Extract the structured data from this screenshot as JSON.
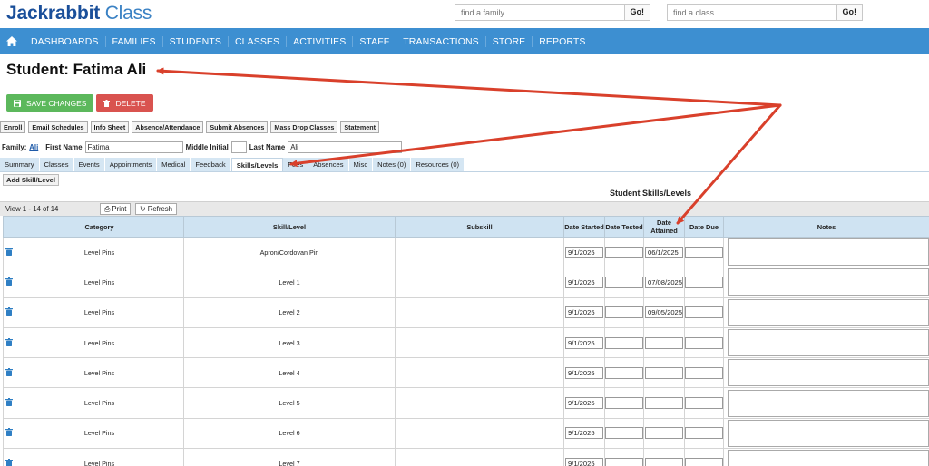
{
  "brand": {
    "bold": "Jackrabbit",
    "light": "Class"
  },
  "search": {
    "family_placeholder": "find a family...",
    "class_placeholder": "find a class...",
    "go_label": "Go!"
  },
  "nav": {
    "items": [
      "DASHBOARDS",
      "FAMILIES",
      "STUDENTS",
      "CLASSES",
      "ACTIVITIES",
      "STAFF",
      "TRANSACTIONS",
      "STORE",
      "REPORTS"
    ]
  },
  "page": {
    "title": "Student: Fatima Ali"
  },
  "buttons": {
    "save": "SAVE CHANGES",
    "delete": "DELETE"
  },
  "actions": [
    "Enroll",
    "Email Schedules",
    "Info Sheet",
    "Absence/Attendance",
    "Submit Absences",
    "Mass Drop Classes",
    "Statement"
  ],
  "student": {
    "family_label": "Family:",
    "family_value": "Ali",
    "first_name_label": "First Name",
    "first_name": "Fatima",
    "middle_label": "Middle Initial",
    "middle": "",
    "last_name_label": "Last Name",
    "last_name": "Ali"
  },
  "tabs": [
    "Summary",
    "Classes",
    "Events",
    "Appointments",
    "Medical",
    "Feedback",
    "Skills/Levels",
    "Fees",
    "Absences",
    "Misc",
    "Notes (0)",
    "Resources (0)"
  ],
  "active_tab": "Skills/Levels",
  "add_skill_label": "Add Skill/Level",
  "section_title": "Student Skills/Levels",
  "viewbar": {
    "count": "View 1 - 14 of 14",
    "print": "Print",
    "refresh": "Refresh"
  },
  "table": {
    "headers": {
      "category": "Category",
      "skill": "Skill/Level",
      "subskill": "Subskill",
      "date_started": "Date Started",
      "date_tested": "Date Tested",
      "date_attained": "Date Attained",
      "date_due": "Date Due",
      "notes": "Notes"
    },
    "rows": [
      {
        "category": "Level Pins",
        "skill": "Apron/Cordovan Pin",
        "subskill": "",
        "started": "9/1/2025",
        "tested": "",
        "attained": "06/1/2025",
        "due": ""
      },
      {
        "category": "Level Pins",
        "skill": "Level 1",
        "subskill": "",
        "started": "9/1/2025",
        "tested": "",
        "attained": "07/08/2025",
        "due": ""
      },
      {
        "category": "Level Pins",
        "skill": "Level 2",
        "subskill": "",
        "started": "9/1/2025",
        "tested": "",
        "attained": "09/05/2025",
        "due": ""
      },
      {
        "category": "Level Pins",
        "skill": "Level 3",
        "subskill": "",
        "started": "9/1/2025",
        "tested": "",
        "attained": "",
        "due": ""
      },
      {
        "category": "Level Pins",
        "skill": "Level 4",
        "subskill": "",
        "started": "9/1/2025",
        "tested": "",
        "attained": "",
        "due": ""
      },
      {
        "category": "Level Pins",
        "skill": "Level 5",
        "subskill": "",
        "started": "9/1/2025",
        "tested": "",
        "attained": "",
        "due": ""
      },
      {
        "category": "Level Pins",
        "skill": "Level 6",
        "subskill": "",
        "started": "9/1/2025",
        "tested": "",
        "attained": "",
        "due": ""
      },
      {
        "category": "Level Pins",
        "skill": "Level 7",
        "subskill": "",
        "started": "9/1/2025",
        "tested": "",
        "attained": "",
        "due": ""
      }
    ]
  },
  "colors": {
    "nav_bg": "#3d8fd1",
    "save_green": "#5cb85c",
    "delete_red": "#d9534f",
    "annotation_arrow": "#d9402b",
    "header_bg": "#cfe3f2",
    "trash_icon": "#2f7fc4"
  },
  "icons": {
    "home": "home-icon",
    "save": "floppy-disk-icon",
    "delete": "trash-icon",
    "print": "printer-icon",
    "refresh": "refresh-icon",
    "row_delete": "trash-icon"
  }
}
